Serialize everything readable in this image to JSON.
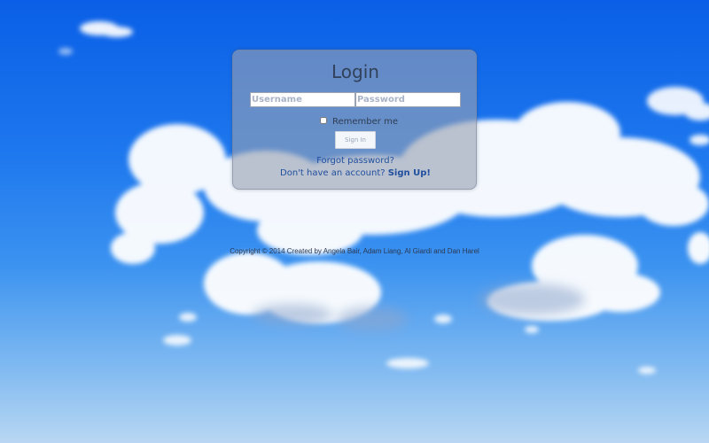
{
  "login": {
    "title": "Login",
    "username_placeholder": "Username",
    "username_value": "",
    "password_placeholder": "Password",
    "password_value": "",
    "remember_label": "Remember me",
    "remember_checked": false,
    "signin_label": "Sign In",
    "forgot_label": "Forgot password?",
    "signup_prompt": "Don't have an account?",
    "signup_label": "Sign Up!"
  },
  "footer": {
    "copyright": "Copyright © 2014 Created by Angela Bair, Adam Liang, Al Giardi and Dan Harel"
  },
  "colors": {
    "sky_top": "#0a5fe6",
    "sky_bottom": "#b9d7f3",
    "card_background": "#96a0b2",
    "link": "#1f4f9e"
  },
  "background": {
    "image": "sky with white clouds"
  }
}
